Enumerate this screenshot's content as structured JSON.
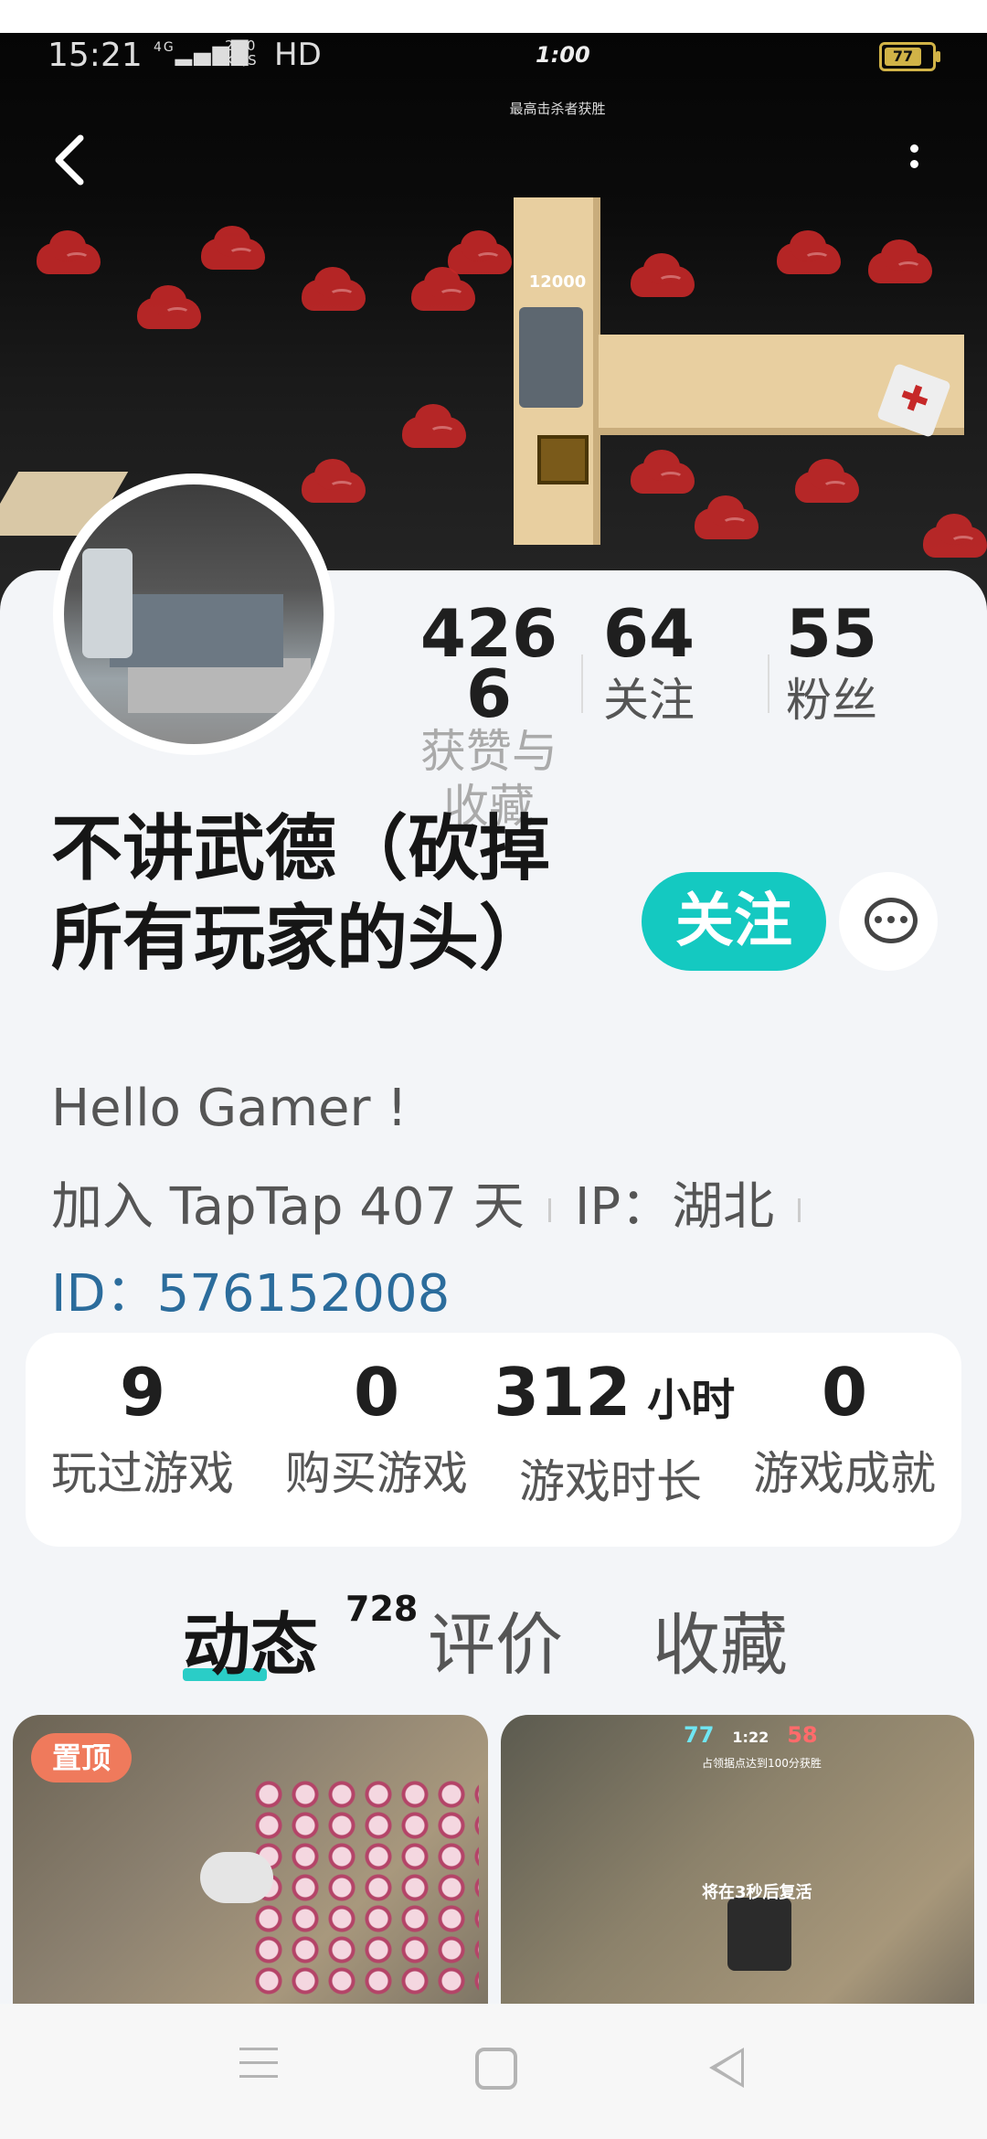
{
  "status_bar": {
    "time": "15:21",
    "network": "4G",
    "speed_value": "24.0",
    "speed_unit": "KB/S",
    "hd": "HD",
    "center_time": "1:00",
    "battery": "77"
  },
  "hero": {
    "caption": "最高击杀者获胜",
    "score": "12000",
    "back_icon": "chevron-left-icon",
    "more_icon": "vertical-dots-icon"
  },
  "profile": {
    "stats": [
      {
        "value": "4266",
        "value_line1": "426",
        "value_line2": "6",
        "label": "获赞与收藏",
        "label_line1": "获赞与",
        "label_line2": "收藏"
      },
      {
        "value": "64",
        "label": "关注"
      },
      {
        "value": "55",
        "label": "粉丝"
      }
    ],
    "name_line1": "不讲武德（砍掉",
    "name_line2": "所有玩家的头）",
    "follow_label": "关注",
    "chat_icon": "chat-bubble-icon",
    "bio": "Hello Gamer !",
    "joined": "加入 TapTap 407 天",
    "ip": "IP：湖北",
    "id": "ID：576152008"
  },
  "game_stats": [
    {
      "value": "9",
      "unit": "",
      "label": "玩过游戏"
    },
    {
      "value": "0",
      "unit": "",
      "label": "购买游戏"
    },
    {
      "value": "312",
      "unit": "小时",
      "label": "游戏时长"
    },
    {
      "value": "0",
      "unit": "",
      "label": "游戏成就"
    }
  ],
  "tabs": [
    {
      "label": "动态",
      "count": "728",
      "active": true
    },
    {
      "label": "评价",
      "active": false
    },
    {
      "label": "收藏",
      "active": false
    }
  ],
  "feed": {
    "pinned_badge": "置顶",
    "thumb2_hud_left": "77",
    "thumb2_hud_time": "1:22",
    "thumb2_hud_right": "58",
    "thumb2_caption": "占领据点达到100分获胜",
    "thumb2_respawn": "将在3秒后复活"
  },
  "nav_bar": {
    "icons": [
      "menu-icon",
      "home-square-icon",
      "back-triangle-icon"
    ]
  },
  "colors": {
    "accent": "#14c9c1",
    "pinned": "#ef7a5c",
    "id_link": "#2b6c9c",
    "background": "#f3f5f8"
  }
}
